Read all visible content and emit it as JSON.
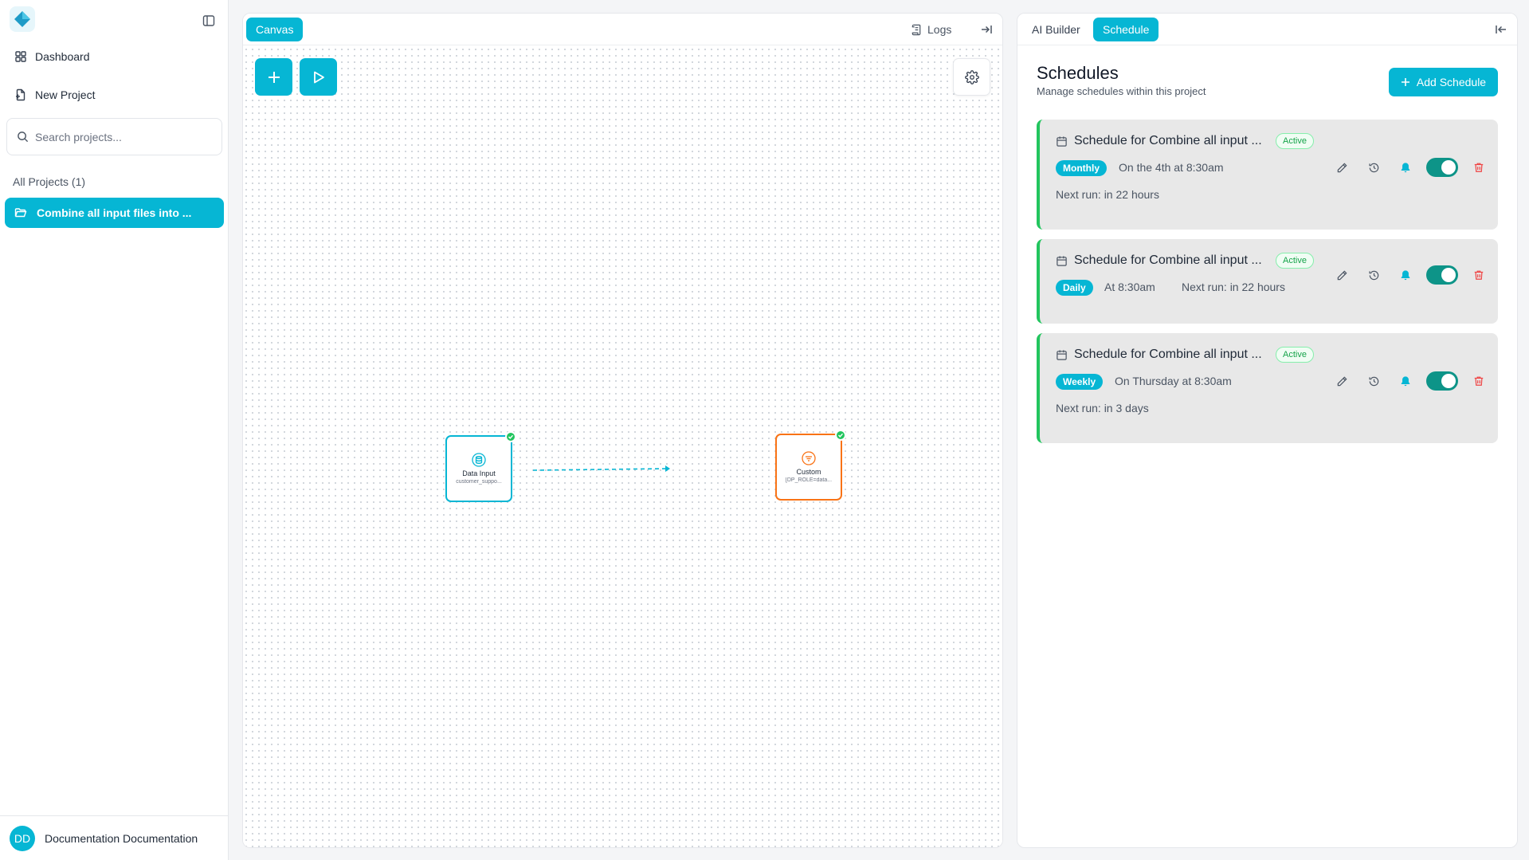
{
  "sidebar": {
    "nav": [
      {
        "label": "Dashboard",
        "icon": "grid-icon"
      },
      {
        "label": "New Project",
        "icon": "new-file-icon"
      }
    ],
    "search_placeholder": "Search projects...",
    "projects_label": "All Projects (1)",
    "active_project": "Combine all input files into ...",
    "user": {
      "initials": "DD",
      "name": "Documentation Documentation"
    }
  },
  "canvas": {
    "tab": "Canvas",
    "logs_label": "Logs",
    "nodes": [
      {
        "title": "Data Input",
        "subtitle": "customer_suppo...",
        "color": "#06b6d4"
      },
      {
        "title": "Custom",
        "subtitle": "[DP_ROLE=data...",
        "color": "#f97316"
      }
    ]
  },
  "right_panel": {
    "tabs": [
      "AI Builder",
      "Schedule"
    ],
    "active_tab": "Schedule",
    "title": "Schedules",
    "subtitle": "Manage schedules within this project",
    "add_label": "Add Schedule",
    "schedules": [
      {
        "title": "Schedule for Combine all input ...",
        "status": "Active",
        "frequency": "Monthly",
        "when": "On the 4th at 8:30am",
        "next_run": "Next run: in 22 hours",
        "enabled": true
      },
      {
        "title": "Schedule for Combine all input ...",
        "status": "Active",
        "frequency": "Daily",
        "when": "At 8:30am",
        "next_run": "Next run: in 22 hours",
        "enabled": true
      },
      {
        "title": "Schedule for Combine all input ...",
        "status": "Active",
        "frequency": "Weekly",
        "when": "On Thursday at 8:30am",
        "next_run": "Next run: in 3 days",
        "enabled": true
      }
    ]
  },
  "colors": {
    "accent": "#06b6d4",
    "active_border": "#22c55e",
    "toggle_on": "#0d9488",
    "delete": "#ef4444",
    "bell": "#06b6d4"
  }
}
